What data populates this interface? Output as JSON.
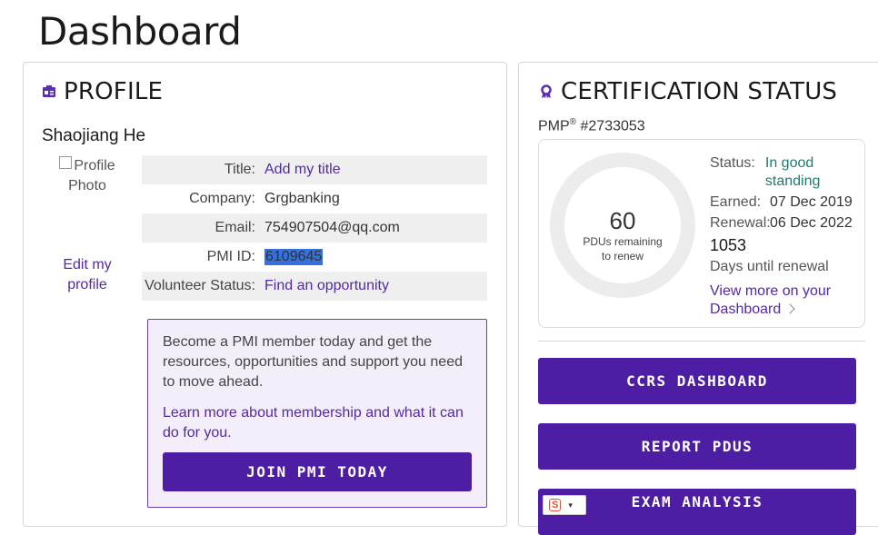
{
  "page": {
    "title": "Dashboard"
  },
  "profile": {
    "heading": "PROFILE",
    "name": "Shaojiang He",
    "photo_alt": "Profile Photo",
    "edit_link": "Edit my profile",
    "fields": [
      {
        "key": "Title:",
        "value": "Add my title",
        "link": true
      },
      {
        "key": "Company:",
        "value": "Grgbanking",
        "link": false
      },
      {
        "key": "Email:",
        "value": "754907504@qq.com",
        "link": false
      },
      {
        "key": "PMI ID:",
        "value": "6109645",
        "link": false,
        "selected": true
      },
      {
        "key": "Volunteer Status:",
        "value": "Find an opportunity",
        "link": true
      }
    ],
    "promo": {
      "text": "Become a PMI member today and get the resources, opportunities and support you need to move ahead.",
      "link": "Learn more about membership and what it can do for you.",
      "button": "JOIN PMI TODAY"
    }
  },
  "certification": {
    "heading": "CERTIFICATION STATUS",
    "cert_name": "PMP",
    "cert_mark": "®",
    "cert_id": "#2733053",
    "pdus_remaining": "60",
    "pdus_label": "PDUs remaining to renew",
    "status_label": "Status:",
    "status_value": "In good standing",
    "earned_label": "Earned:",
    "earned_value": "07 Dec 2019",
    "renewal_label": "Renewal:",
    "renewal_value": "06 Dec 2022",
    "days_until_renewal": "1053",
    "days_label": "Days until renewal",
    "view_more": "View more on your Dashboard",
    "buttons": {
      "ccrs": "CCRS DASHBOARD",
      "report": "REPORT PDUS",
      "exam": "EXAM ANALYSIS"
    },
    "extension_badge": "S"
  },
  "colors": {
    "brand_purple": "#4d1ea3",
    "link_purple": "#5329a6",
    "status_green": "#217a6f"
  }
}
